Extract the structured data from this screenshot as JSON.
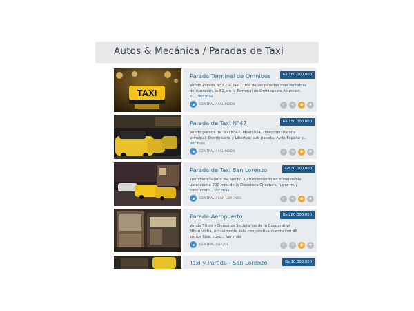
{
  "page": {
    "title": "Autos & Mecánica / Paradas de Taxi"
  },
  "listings": [
    {
      "title": "Parada Terminal de Ómnibus",
      "price": "Gs 160.000.000",
      "desc": "Vendo Parada N° 52 + Taxi . Una de las paradas mas rentables de Asunción, la 52, en la Terminal de Omnibus de Asunción. El...",
      "more": "Ver más",
      "location": "CENTRAL / ASUNCIÓN"
    },
    {
      "title": "Parada de Taxi N°47",
      "price": "Gs 150.000.000",
      "desc": "Vendo parada de Taxi N°47, Movil 024. Dirección: Parada principal: Dominicana y Libertad; sub-parada: Avda España y...",
      "more": "Ver más",
      "location": "CENTRAL / ASUNCIÓN"
    },
    {
      "title": "Parada de Taxi San Lorenzo",
      "price": "Gs 30.000.000",
      "desc": "Transfiero Parada de Taxi N° 10 funcionando en inmejorable ubicación a 200 mts. de la Discoteca Checho's, lugar muy concurrido...",
      "more": "Ver más",
      "location": "CENTRAL / SAN LORENZO"
    },
    {
      "title": "Parada Aeropuerto",
      "price": "Gs 280.000.000",
      "desc": "Vendo Título y Derechos Societarios de la Cooperativa Mburuvicha, actualmente ésta cooperativa cuenta con 48 socios fijos, cuyo...",
      "more": "Ver más",
      "location": "CENTRAL / LUQUE"
    },
    {
      "title": "Taxi y Parada - San Lorenzo",
      "price": "Gs 10.000.000"
    }
  ],
  "thumb_text": {
    "taxi_sign": "TAXI"
  },
  "icons": [
    "location-pin-icon",
    "check-icon",
    "share-icon",
    "rss-icon",
    "star-icon"
  ],
  "colors": {
    "accent": "#1f5a8d",
    "link": "#2f6e9a",
    "orange": "#f0a325",
    "pin": "#3e8fd1"
  }
}
